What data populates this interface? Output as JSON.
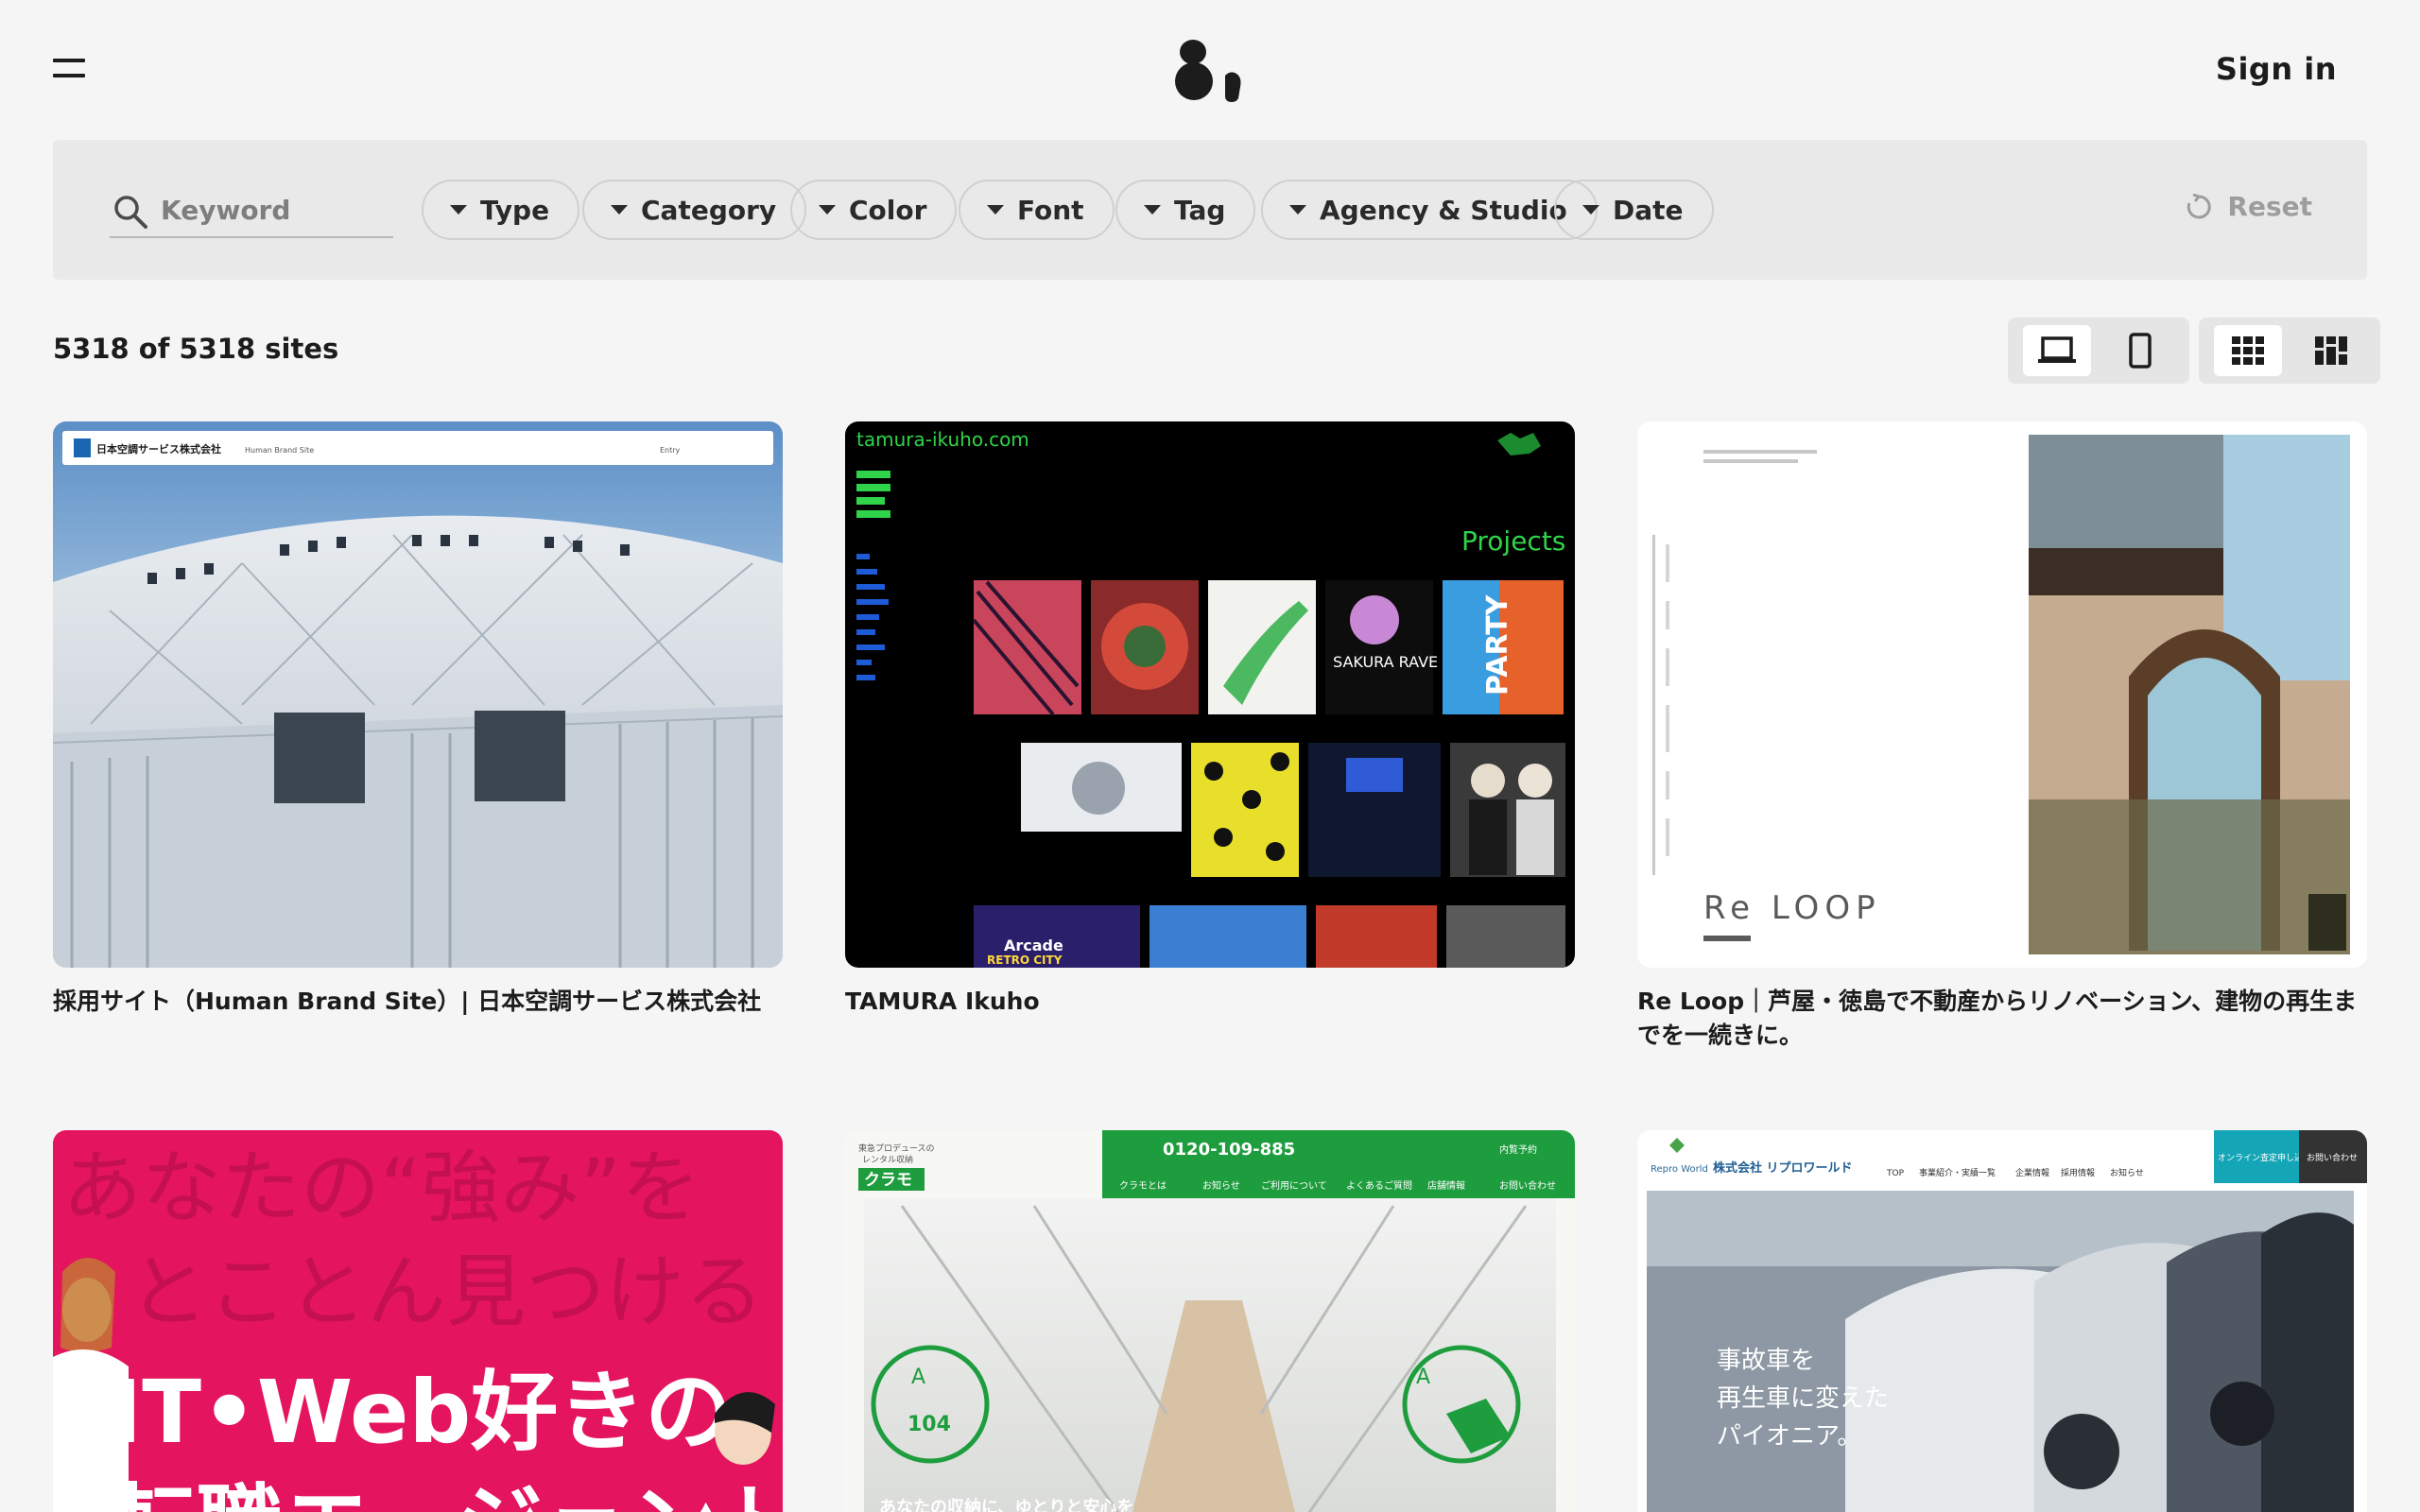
{
  "header": {
    "menu_icon": "hamburger-menu-icon",
    "logo_icon": "81-logo-icon",
    "signin_label": "Sign in"
  },
  "filters": {
    "search_placeholder": "Keyword",
    "search_value": "",
    "chips": [
      "Type",
      "Category",
      "Color",
      "Font",
      "Tag",
      "Agency & Studio",
      "Date"
    ],
    "reset_label": "Reset"
  },
  "results": {
    "count_text": "5318 of 5318 sites"
  },
  "view_toggles": {
    "device": [
      {
        "name": "desktop-view",
        "icon": "laptop-icon",
        "active": true
      },
      {
        "name": "mobile-view",
        "icon": "phone-icon",
        "active": false
      }
    ],
    "layout": [
      {
        "name": "grid-view",
        "icon": "grid-icon",
        "active": true
      },
      {
        "name": "masonry-view",
        "icon": "masonry-icon",
        "active": false
      }
    ]
  },
  "sites": [
    {
      "title": "採用サイト（Human Brand Site）| 日本空調サービス株式会社",
      "screenshot_text": [
        "日本空調サービス株式会社",
        "Human Brand Site",
        "Entry"
      ]
    },
    {
      "title": "TAMURA Ikuho",
      "screenshot_text": [
        "tamura-ikuho.com",
        "Projects",
        "SAKURA RAVE",
        "PARTY",
        "Arcade",
        "RETRO CITY"
      ]
    },
    {
      "title": "Re Loop｜芦屋・徳島で不動産からリノベーション、建物の再生までを一続きに。",
      "screenshot_text": [
        "Re LOOP"
      ]
    },
    {
      "title": "",
      "screenshot_text": [
        "あなたの“強み”を",
        "とことん見つける",
        "IT•Web好きの",
        "転職エージェント"
      ]
    },
    {
      "title": "",
      "screenshot_text": [
        "クラモ",
        "0120-109-885",
        "クラモとは",
        "お知らせ",
        "ご利用について",
        "よくあるご質問",
        "店舗情報",
        "内覧予約",
        "お問い合わせ",
        "あなたの収納に、ゆとりと安心を"
      ]
    },
    {
      "title": "",
      "screenshot_text": [
        "Repro World",
        "株式会社 リプロワールド",
        "TOP",
        "事業紹介・実績一覧",
        "企業情報",
        "採用情報",
        "お知らせ",
        "オンライン査定申し込み",
        "お問い合わせ",
        "事故車を",
        "再生車に変えた",
        "パイオニア。"
      ]
    }
  ],
  "colors": {
    "background": "#f4f5f4",
    "filter_bar": "#e8e9e8",
    "text": "#1c1c1c",
    "muted": "#9c9d9c",
    "magenta": "#e4145e",
    "green": "#1e9d3e"
  }
}
